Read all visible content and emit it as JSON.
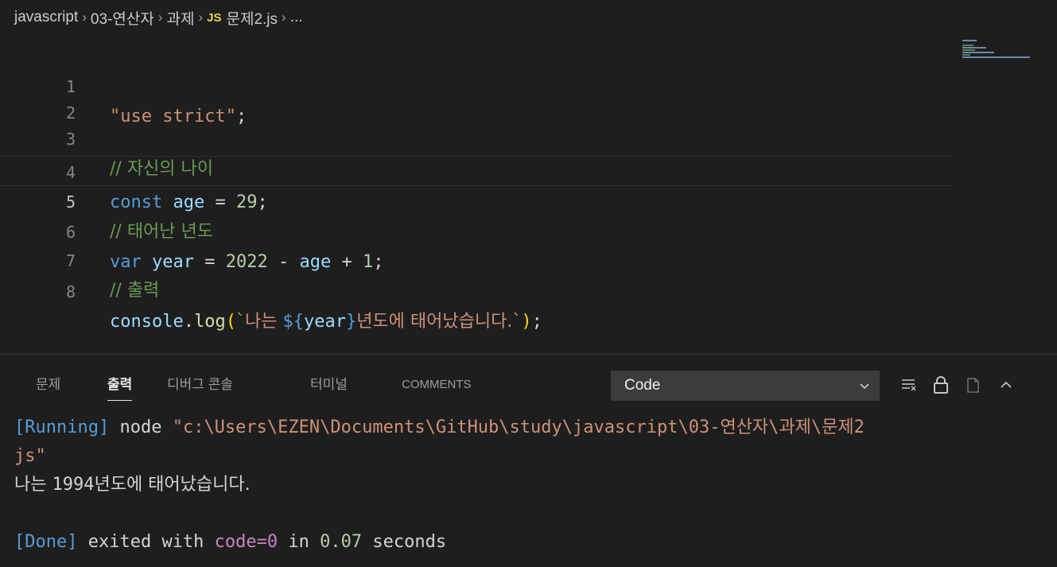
{
  "breadcrumb": {
    "items": [
      "javascript",
      "03-연산자",
      "과제"
    ],
    "file_badge": "JS",
    "file_name": "문제2.js",
    "ellipsis": "..."
  },
  "editor": {
    "lines": [
      {
        "num": "1"
      },
      {
        "num": "2"
      },
      {
        "num": "3"
      },
      {
        "num": "4"
      },
      {
        "num": "5"
      },
      {
        "num": "6"
      },
      {
        "num": "7"
      },
      {
        "num": "8"
      }
    ],
    "tokens": {
      "l1_str": "\"use strict\"",
      "l1_semi": ";",
      "l3_cmt": "// 자신의 나이",
      "l4_kw": "const",
      "l4_var": "age",
      "l4_eq": "=",
      "l4_num": "29",
      "l4_semi": ";",
      "l5_cmt": "// 태어난 년도",
      "l6_kw": "var",
      "l6_var": "year",
      "l6_eq": "=",
      "l6_num1": "2022",
      "l6_minus": "-",
      "l6_age": "age",
      "l6_plus": "+",
      "l6_num2": "1",
      "l6_semi": ";",
      "l7_cmt": "// 출력",
      "l8_obj": "console",
      "l8_dot": ".",
      "l8_fn": "log",
      "l8_open": "(",
      "l8_tpl_start": "`나는 ",
      "l8_interp_open": "${",
      "l8_interp_var": "year",
      "l8_interp_close": "}",
      "l8_tpl_end": "년도에 태어났습니다.`",
      "l8_close": ")",
      "l8_semi": ";"
    }
  },
  "panel": {
    "tabs": [
      {
        "label": "문제"
      },
      {
        "label": "출력"
      },
      {
        "label": "디버그 콘솔"
      },
      {
        "label": "터미널"
      },
      {
        "label": "COMMENTS"
      }
    ],
    "active_tab": "출력",
    "channel_value": "Code"
  },
  "output": {
    "run_tag": "[Running]",
    "run_cmd": " node ",
    "run_path1": "\"c:\\Users\\EZEN\\Documents\\GitHub\\study\\javascript\\03-연산자\\과제\\문제2",
    "run_path2": "js\"",
    "result_a": "나는 ",
    "result_num": "1994",
    "result_b": "년도에 태어났습니다.",
    "done_tag": "[Done]",
    "done_a": " exited with ",
    "done_code": "code=0",
    "done_b": " in ",
    "done_time": "0.07",
    "done_c": " seconds"
  },
  "colors": {
    "background": "#1e1e1e",
    "keyword": "#569cd6",
    "string": "#ce9178",
    "comment": "#6a9955",
    "number": "#b5cea8",
    "variable": "#9cdcfe",
    "function": "#dcdcaa",
    "bracket": "#ffd700"
  }
}
